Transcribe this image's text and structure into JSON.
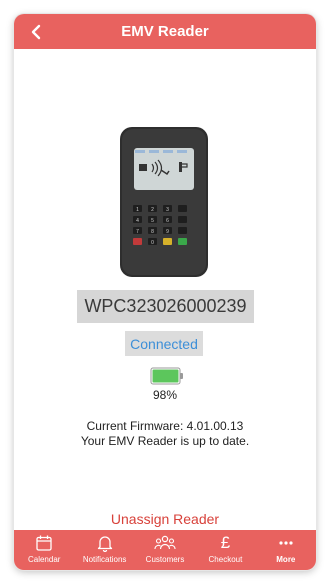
{
  "header": {
    "title": "EMV Reader",
    "back_icon": "chevron-left-icon"
  },
  "device": {
    "serial_number": "WPC323026000239",
    "status": "Connected",
    "battery_percent": "98%",
    "battery_level": 0.98,
    "firmware_line": "Current Firmware: 4.01.00.13",
    "update_status": "Your EMV Reader is up to date.",
    "screen_icons": [
      "contactless-card-icon",
      "insert-card-icon"
    ],
    "keypad_keys": [
      "1",
      "2",
      "3",
      "4",
      "5",
      "6",
      "7",
      "8",
      "9",
      "",
      "0",
      ""
    ]
  },
  "actions": {
    "unassign_label": "Unassign Reader"
  },
  "tabbar": {
    "items": [
      {
        "label": "Calendar",
        "icon": "calendar-icon"
      },
      {
        "label": "Notifications",
        "icon": "bell-icon"
      },
      {
        "label": "Customers",
        "icon": "people-icon"
      },
      {
        "label": "Checkout",
        "icon": "pound-icon"
      },
      {
        "label": "More",
        "icon": "more-dots-icon",
        "active": true
      }
    ]
  },
  "colors": {
    "brand": "#e8625f",
    "link": "#3d8fd8",
    "destructive": "#d8413a",
    "battery": "#5cc65c"
  }
}
